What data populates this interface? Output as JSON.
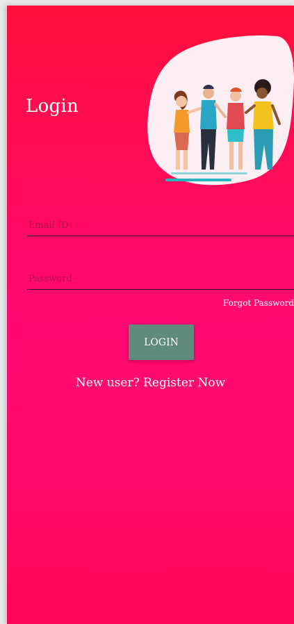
{
  "screen": {
    "title": "Login"
  },
  "form": {
    "email_placeholder": "Email ID",
    "email_value": "",
    "password_placeholder": "Password",
    "password_value": "",
    "forgot_password_label": "Forgot Password",
    "login_button_label": "LOGIN",
    "register_link_label": "New user? Register Now"
  },
  "illustration": {
    "icon": "group-of-friends-illustration"
  },
  "colors": {
    "background_top": "#ff0f3c",
    "background_mid": "#ff0a72",
    "login_button": "#5f8a7c",
    "text": "#ffffff"
  }
}
